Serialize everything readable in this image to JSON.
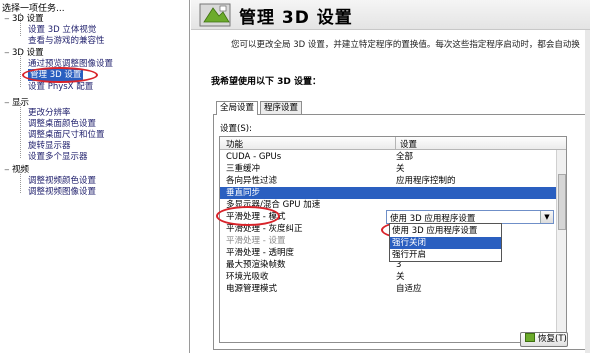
{
  "left_panel": {
    "task_title": "选择一项任务...",
    "tree": [
      {
        "label": "3D 设置",
        "level": 0,
        "expanded": true
      },
      {
        "label": "设置 3D 立体视觉",
        "level": 1
      },
      {
        "label": "查看与游戏的兼容性",
        "level": 1
      },
      {
        "label": "3D 设置",
        "level": 0,
        "expanded": true
      },
      {
        "label": "通过预览调整图像设置",
        "level": 1
      },
      {
        "label": "管理 3D 设置",
        "level": 1,
        "selected": true
      },
      {
        "label": "设置 PhysX 配置",
        "level": 1
      },
      {
        "label": "显示",
        "level": 0,
        "expanded": true
      },
      {
        "label": "更改分辨率",
        "level": 1
      },
      {
        "label": "调整桌面颜色设置",
        "level": 1
      },
      {
        "label": "调整桌面尺寸和位置",
        "level": 1
      },
      {
        "label": "旋转显示器",
        "level": 1
      },
      {
        "label": "设置多个显示器",
        "level": 1
      },
      {
        "label": "视频",
        "level": 0,
        "expanded": true
      },
      {
        "label": "调整视频颜色设置",
        "level": 1
      },
      {
        "label": "调整视频图像设置",
        "level": 1
      }
    ]
  },
  "header": {
    "title": "管理 3D 设置",
    "description": "您可以更改全局 3D 设置，并建立特定程序的置换值。每次这些指定程序启动时，都会自动换"
  },
  "main": {
    "prompt": "我希望使用以下 3D 设置：",
    "tabs": [
      {
        "label": "全局设置",
        "active": true
      },
      {
        "label": "程序设置",
        "active": false
      }
    ],
    "settings_label": "设置(S):",
    "columns": [
      "功能",
      "设置"
    ],
    "rows": [
      {
        "feature": "CUDA - GPUs",
        "setting": "全部"
      },
      {
        "feature": "三重缓冲",
        "setting": "关"
      },
      {
        "feature": "各向异性过滤",
        "setting": "应用程序控制的"
      },
      {
        "feature": "垂直同步",
        "setting": "使用 3D 应用程序设置",
        "selected": true
      },
      {
        "feature": "多显示器/混合 GPU 加速",
        "setting": ""
      },
      {
        "feature": "平滑处理 - 模式",
        "setting": ""
      },
      {
        "feature": "平滑处理 - 灰度纠正",
        "setting": ""
      },
      {
        "feature": "平滑处理 - 设置",
        "setting": "应用程序控制的",
        "dim": true
      },
      {
        "feature": "平滑处理 - 透明度",
        "setting": "关"
      },
      {
        "feature": "最大预渲染帧数",
        "setting": "3"
      },
      {
        "feature": "环境光吸收",
        "setting": "关"
      },
      {
        "feature": "电源管理模式",
        "setting": "自适应"
      }
    ],
    "dropdown": {
      "value": "使用 3D 应用程序设置",
      "options": [
        "使用 3D 应用程序设置",
        "强行关闭",
        "强行开启"
      ],
      "highlighted_index": 1
    },
    "restore_label": "恢复(T)"
  },
  "colors": {
    "selection": "#2a5fc0",
    "annotation": "#d8232a",
    "nvidia_green": "#6cab2c"
  }
}
